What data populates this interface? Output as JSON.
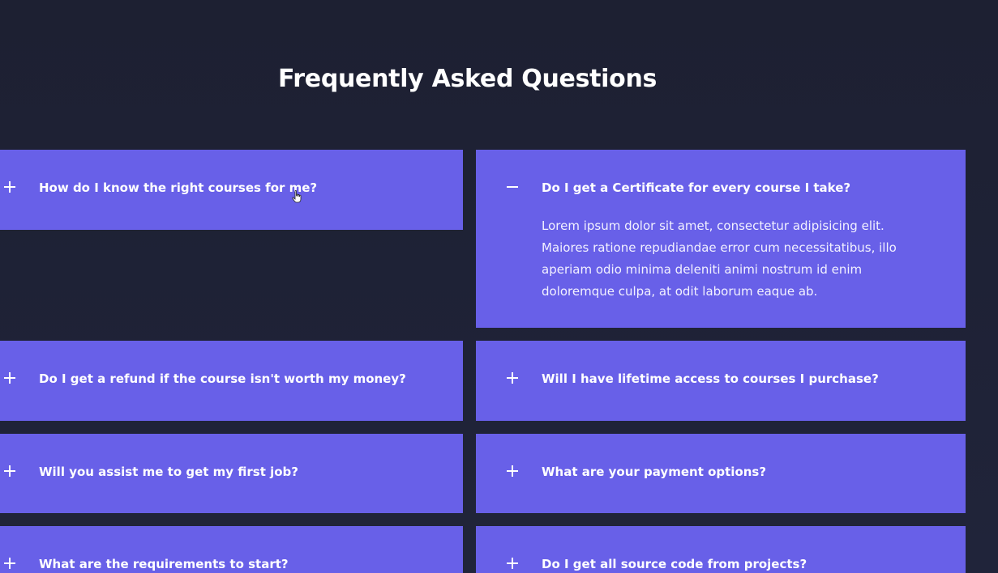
{
  "section": {
    "title": "Frequently Asked Questions"
  },
  "faq": {
    "items": [
      {
        "question": "How do I know the right courses for me?",
        "expanded": false,
        "icon": "plus-icon"
      },
      {
        "question": "Do I get a Certificate for every course I take?",
        "expanded": true,
        "icon": "minus-icon",
        "answer": "Lorem ipsum dolor sit amet, consectetur adipisicing elit. Maiores ratione repudiandae error cum necessitatibus, illo aperiam odio minima deleniti animi nostrum id enim doloremque culpa, at odit laborum eaque ab."
      },
      {
        "question": "Do I get a refund if the course isn't worth my money?",
        "expanded": false,
        "icon": "plus-icon"
      },
      {
        "question": "Will I have lifetime access to courses I purchase?",
        "expanded": false,
        "icon": "plus-icon"
      },
      {
        "question": "Will you assist me to get my first job?",
        "expanded": false,
        "icon": "plus-icon"
      },
      {
        "question": "What are your payment options?",
        "expanded": false,
        "icon": "plus-icon"
      },
      {
        "question": "What are the requirements to start?",
        "expanded": false,
        "icon": "plus-icon"
      },
      {
        "question": "Do I get all source code from projects?",
        "expanded": false,
        "icon": "plus-icon"
      }
    ]
  },
  "colors": {
    "background": "#1f2234",
    "card": "#6860e8",
    "text": "#ffffff"
  }
}
